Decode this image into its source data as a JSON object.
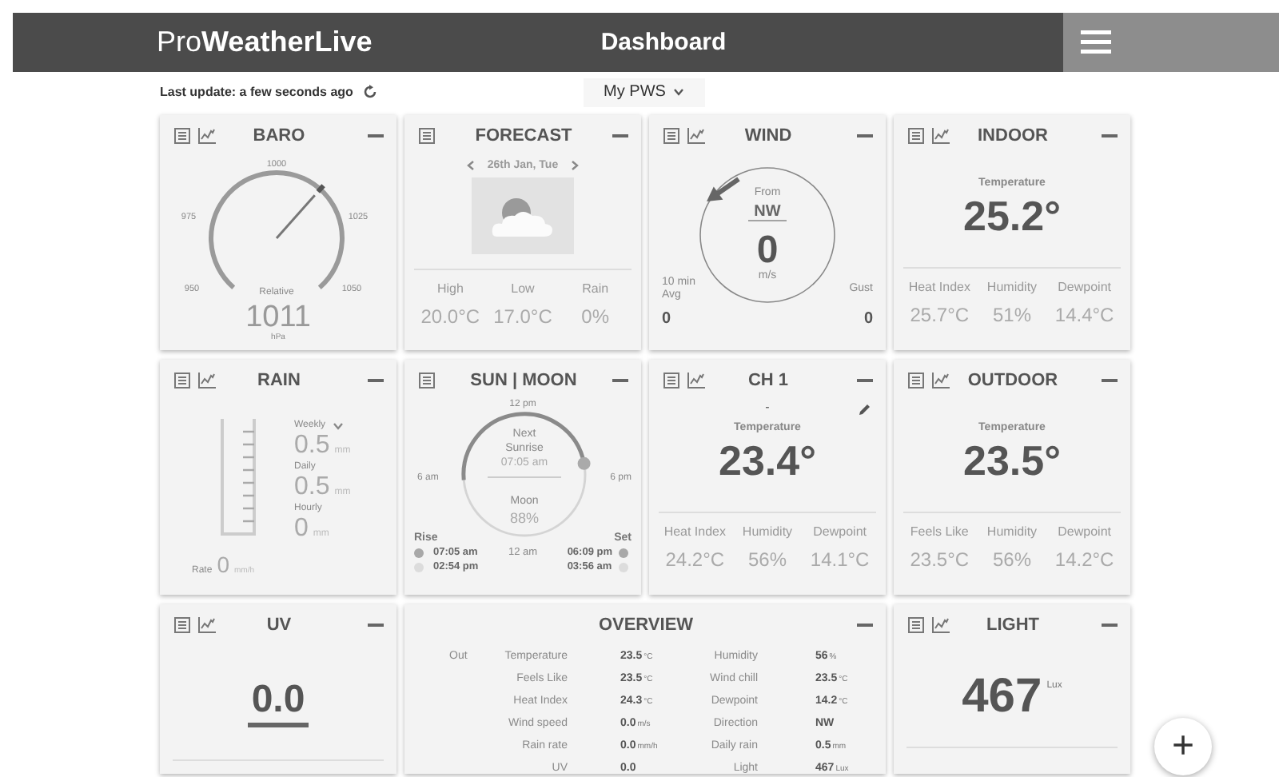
{
  "header": {
    "logo": "Pro**WeatherLive**",
    "title": "Dashboard"
  },
  "toolbar": {
    "last_update": "Last update: a few seconds ago",
    "station": "My PWS"
  },
  "cards": [
    {
      "kind": "baro",
      "title": "BARO",
      "table_button": true,
      "chart_button": true,
      "scale": [
        "1000",
        "975",
        "1025",
        "950",
        "1050"
      ],
      "caption": "Relative",
      "value": "1011",
      "unit": "hPa",
      "level": 0.65
    },
    {
      "kind": "forecast",
      "title": "FORECAST",
      "table_button": true,
      "chart_button": false,
      "date": "26th Jan, Tue",
      "stats": [
        {
          "label": "High",
          "value": "20.0°C"
        },
        {
          "label": "Low",
          "value": "17.0°C"
        },
        {
          "label": "Rain",
          "value": "0%"
        }
      ]
    },
    {
      "kind": "wind",
      "title": "WIND",
      "table_button": true,
      "chart_button": true,
      "from_label": "From",
      "direction": "NW",
      "value": "0",
      "unit": "m/s",
      "avg_label": "10 min Avg",
      "avg_value": "0",
      "gust_label": "Gust",
      "gust_value": "0"
    },
    {
      "kind": "temperature",
      "title": "INDOOR",
      "table_button": true,
      "chart_button": true,
      "editable": false,
      "label": "Temperature",
      "value": "25.2°",
      "stats": [
        {
          "label": "Heat Index",
          "value": "25.7°C"
        },
        {
          "label": "Humidity",
          "value": "51%"
        },
        {
          "label": "Dewpoint",
          "value": "14.4°C"
        }
      ]
    },
    {
      "kind": "rain",
      "title": "RAIN",
      "table_button": true,
      "chart_button": true,
      "readings": [
        {
          "label": "Weekly",
          "value": "0.5",
          "unit": "mm",
          "dropdown": true
        },
        {
          "label": "Daily",
          "value": "0.5",
          "unit": "mm",
          "dropdown": false
        },
        {
          "label": "Hourly",
          "value": "0",
          "unit": "mm",
          "dropdown": false
        }
      ],
      "rate_label": "Rate",
      "rate_value": "0",
      "rate_unit": "mm/h"
    },
    {
      "kind": "sun_moon",
      "title": "SUN | MOON",
      "table_button": true,
      "chart_button": false,
      "dial": {
        "top": "12 pm",
        "left": "6 am",
        "right": "6 pm",
        "bottom": "12 am"
      },
      "next_label": "Next Sunrise",
      "next_time": "07:05 am",
      "moon_label": "Moon",
      "moon_value": "88%",
      "rise_label": "Rise",
      "set_label": "Set",
      "rows": [
        {
          "kind": "sun",
          "rise": "07:05 am",
          "set": "06:09 pm"
        },
        {
          "kind": "moon",
          "rise": "02:54 pm",
          "set": "03:56 am"
        }
      ],
      "level": 0.94
    },
    {
      "kind": "temperature",
      "title": "CH 1",
      "table_button": true,
      "chart_button": true,
      "subtitle": "-",
      "editable": true,
      "label": "Temperature",
      "value": "23.4°",
      "stats": [
        {
          "label": "Heat Index",
          "value": "24.2°C"
        },
        {
          "label": "Humidity",
          "value": "56%"
        },
        {
          "label": "Dewpoint",
          "value": "14.1°C"
        }
      ]
    },
    {
      "kind": "temperature",
      "title": "OUTDOOR",
      "table_button": true,
      "chart_button": true,
      "editable": false,
      "label": "Temperature",
      "value": "23.5°",
      "stats": [
        {
          "label": "Feels Like",
          "value": "23.5°C"
        },
        {
          "label": "Humidity",
          "value": "56%"
        },
        {
          "label": "Dewpoint",
          "value": "14.2°C"
        }
      ]
    },
    {
      "kind": "uv",
      "title": "UV",
      "table_button": true,
      "chart_button": true,
      "value": "0.0"
    },
    {
      "kind": "overview",
      "title": "OVERVIEW",
      "table_button": false,
      "chart_button": false,
      "group": "Out",
      "rows": [
        {
          "label": "Temperature",
          "value": "23.5",
          "unit": "°C",
          "label_2": "Humidity",
          "value_2": "56",
          "unit_2": "%"
        },
        {
          "label": "Feels Like",
          "value": "23.5",
          "unit": "°C",
          "label_2": "Wind chill",
          "value_2": "23.5",
          "unit_2": "°C"
        },
        {
          "label": "Heat Index",
          "value": "24.3",
          "unit": "°C",
          "label_2": "Dewpoint",
          "value_2": "14.2",
          "unit_2": "°C"
        },
        {
          "label": "Wind speed",
          "value": "0.0",
          "unit": "m/s",
          "label_2": "Direction",
          "value_2": "NW"
        },
        {
          "label": "Rain rate",
          "value": "0.0",
          "unit": "mm/h",
          "label_2": "Daily rain",
          "value_2": "0.5",
          "unit_2": "mm"
        },
        {
          "label": "UV",
          "value": "0.0",
          "label_2": "Light",
          "value_2": "467",
          "unit_2": "Lux"
        }
      ]
    },
    {
      "kind": "light",
      "title": "LIGHT",
      "table_button": true,
      "chart_button": true,
      "value": "467",
      "unit": "Lux"
    }
  ],
  "fab": {
    "label": "+"
  }
}
